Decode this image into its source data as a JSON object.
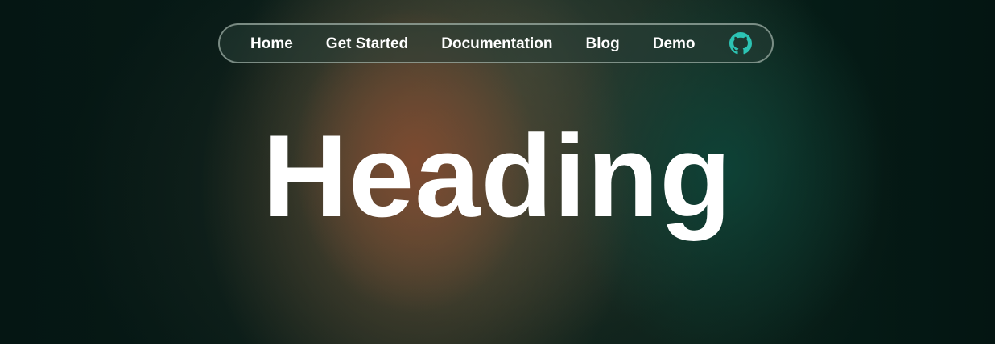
{
  "nav": {
    "items": [
      {
        "label": "Home"
      },
      {
        "label": "Get Started"
      },
      {
        "label": "Documentation"
      },
      {
        "label": "Blog"
      },
      {
        "label": "Demo"
      }
    ],
    "github_icon": "github-icon",
    "github_color": "#2cc3b3"
  },
  "hero": {
    "heading": "Heading"
  },
  "colors": {
    "background": "#041714",
    "text": "#ffffff",
    "accent_warm": "#7e4a30",
    "accent_teal": "#0c463a"
  }
}
